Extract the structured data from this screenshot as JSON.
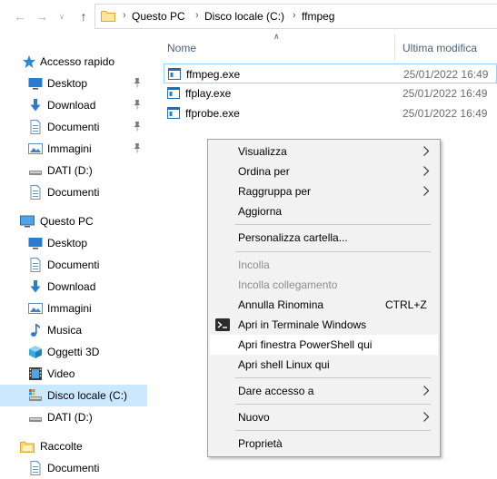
{
  "address": {
    "crumbs": [
      "Questo PC",
      "Disco locale (C:)",
      "ffmpeg"
    ]
  },
  "nav": {
    "items": [
      {
        "label": "Accesso rapido",
        "icon": "star-icon",
        "pinned": false
      },
      {
        "label": "Desktop",
        "icon": "desktop-icon",
        "pinned": true
      },
      {
        "label": "Download",
        "icon": "download-icon",
        "pinned": true
      },
      {
        "label": "Documenti",
        "icon": "documents-icon",
        "pinned": true
      },
      {
        "label": "Immagini",
        "icon": "pictures-icon",
        "pinned": true
      },
      {
        "label": "DATI (D:)",
        "icon": "drive-icon",
        "pinned": false
      },
      {
        "label": "Documenti",
        "icon": "documents-icon",
        "pinned": false
      },
      {
        "label": "Questo PC",
        "icon": "computer-icon",
        "pinned": false
      },
      {
        "label": "Desktop",
        "icon": "desktop-icon",
        "pinned": false
      },
      {
        "label": "Documenti",
        "icon": "documents-icon",
        "pinned": false
      },
      {
        "label": "Download",
        "icon": "download-icon",
        "pinned": false
      },
      {
        "label": "Immagini",
        "icon": "pictures-icon",
        "pinned": false
      },
      {
        "label": "Musica",
        "icon": "music-icon",
        "pinned": false
      },
      {
        "label": "Oggetti 3D",
        "icon": "3d-objects-icon",
        "pinned": false
      },
      {
        "label": "Video",
        "icon": "video-icon",
        "pinned": false
      },
      {
        "label": "Disco locale (C:)",
        "icon": "system-drive-icon",
        "pinned": false,
        "selected": true
      },
      {
        "label": "DATI (D:)",
        "icon": "drive-icon",
        "pinned": false
      },
      {
        "label": "Raccolte",
        "icon": "libraries-icon",
        "pinned": false
      },
      {
        "label": "Documenti",
        "icon": "documents-icon",
        "pinned": false
      }
    ]
  },
  "columns": {
    "name": "Nome",
    "modified": "Ultima modifica"
  },
  "files": [
    {
      "name": "ffmpeg.exe",
      "date": "25/01/2022 16:49"
    },
    {
      "name": "ffplay.exe",
      "date": "25/01/2022 16:49"
    },
    {
      "name": "ffprobe.exe",
      "date": "25/01/2022 16:49"
    }
  ],
  "menu": {
    "items": [
      {
        "label": "Visualizza",
        "submenu": true
      },
      {
        "label": "Ordina per",
        "submenu": true
      },
      {
        "label": "Raggruppa per",
        "submenu": true
      },
      {
        "label": "Aggiorna"
      },
      {
        "label": "Personalizza cartella..."
      },
      {
        "label": "Incolla",
        "disabled": true
      },
      {
        "label": "Incolla collegamento",
        "disabled": true
      },
      {
        "label": "Annulla Rinomina",
        "shortcut": "CTRL+Z"
      },
      {
        "label": "Apri in Terminale Windows",
        "icon": "terminal-icon"
      },
      {
        "label": "Apri finestra PowerShell qui",
        "hover": true
      },
      {
        "label": "Apri shell Linux qui"
      },
      {
        "label": "Dare accesso a",
        "submenu": true
      },
      {
        "label": "Nuovo",
        "submenu": true
      },
      {
        "label": "Proprietà"
      }
    ]
  },
  "colors": {
    "selection": "#cce8ff",
    "header_text": "#4c607a",
    "menu_bg": "#f2f2f2",
    "accent_blue": "#1e73be"
  }
}
